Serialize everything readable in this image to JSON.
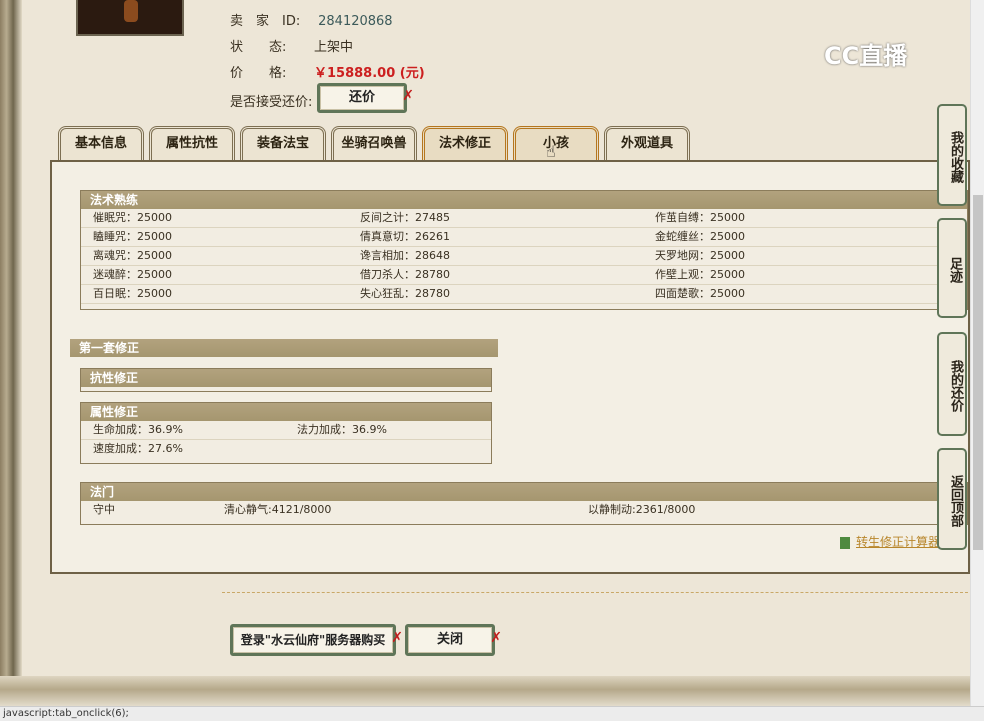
{
  "header": {
    "seller_label": "卖　家",
    "id_label": "ID:",
    "seller_id": "284120868",
    "status_label": "状　　态:",
    "status": "上架中",
    "price_label": "价　　格:",
    "price": "￥15888.00 (元)",
    "counteroffer_label": "是否接受还价:",
    "counteroffer_button": "还价"
  },
  "logo": "CC直播",
  "tabs": [
    "基本信息",
    "属性抗性",
    "装备法宝",
    "坐骑召唤兽",
    "法术修正",
    "小孩",
    "外观道具"
  ],
  "spell_mastery": {
    "title": "法术熟练",
    "rows": [
      [
        "催眠咒：25000",
        "反间之计：27485",
        "作茧自缚：25000"
      ],
      [
        "瞌睡咒：25000",
        "倩真意切：26261",
        "金蛇缠丝：25000"
      ],
      [
        "离魂咒：25000",
        "谗言相加：28648",
        "天罗地网：25000"
      ],
      [
        "迷魂醉：25000",
        "借刀杀人：28780",
        "作壁上观：25000"
      ],
      [
        "百日眠：25000",
        "失心狂乱：28780",
        "四面楚歌：25000"
      ]
    ]
  },
  "set1": {
    "title": "第一套修正",
    "resist_title": "抗性修正",
    "attr_title": "属性修正",
    "attr_rows": [
      [
        "生命加成：36.9%",
        "法力加成：36.9%"
      ],
      [
        "速度加成：27.6%",
        ""
      ]
    ]
  },
  "sect": {
    "title": "法门",
    "items": [
      "守中",
      "清心静气:4121/8000",
      "以静制动:2361/8000"
    ]
  },
  "calc_link": "转生修正计算器",
  "buttons": {
    "login_buy": "登录\"水云仙府\"服务器购买",
    "close": "关闭"
  },
  "right_tabs": [
    "我的收藏",
    "足迹",
    "我的还价",
    "返回顶部"
  ],
  "status_bar": "javascript:tab_onclick(6);"
}
